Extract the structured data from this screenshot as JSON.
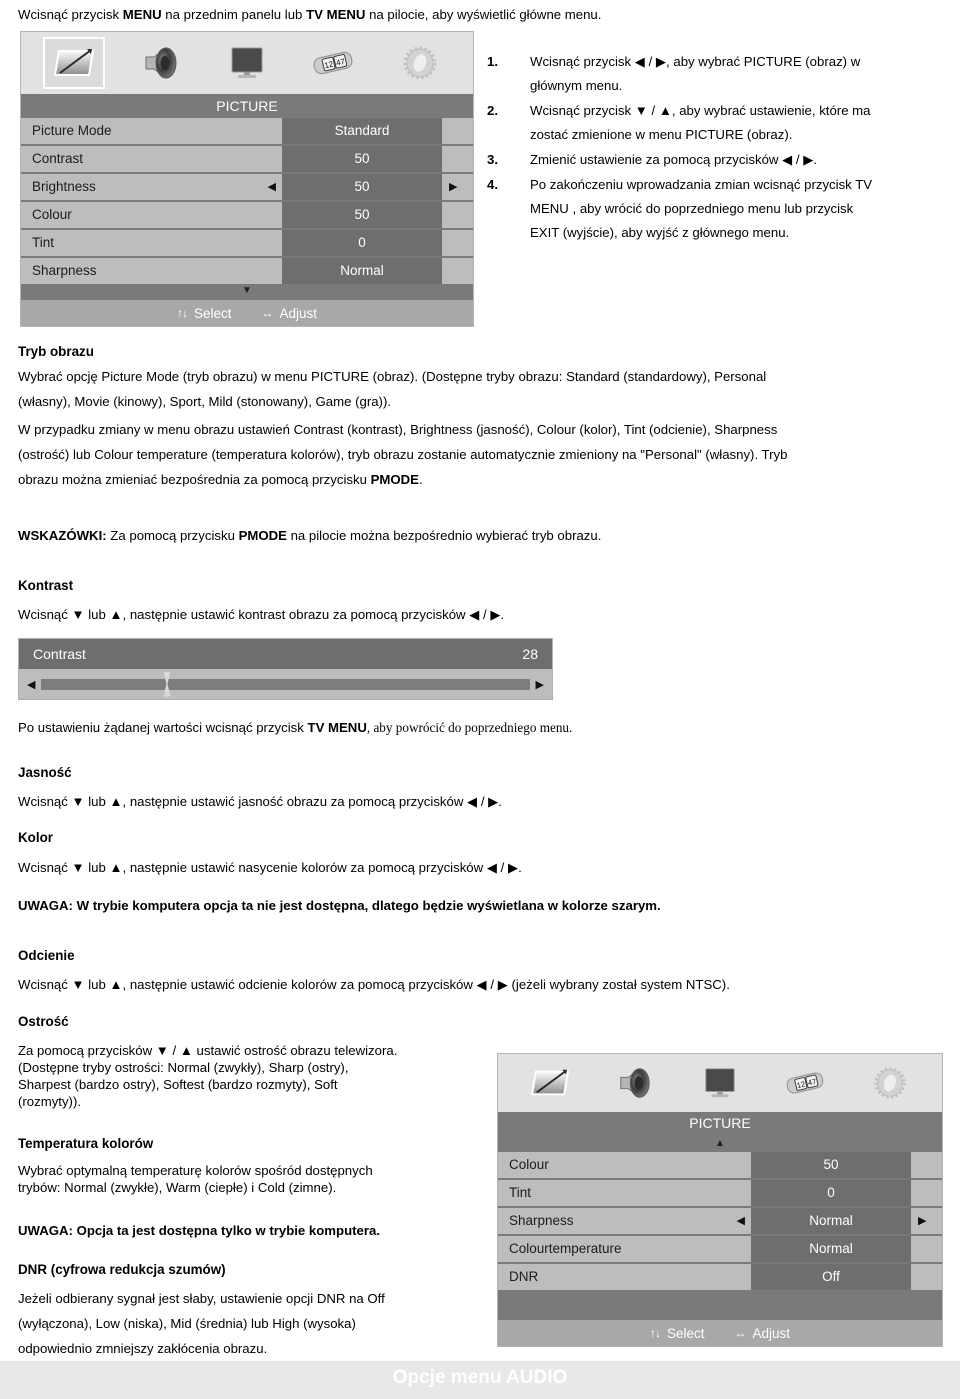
{
  "intro": {
    "before": "Wcisnąć przycisk ",
    "b1": "MENU",
    "mid": " na przednim panelu lub ",
    "b2": "TV MENU",
    "after": " na pilocie, aby wyświetlić główne menu."
  },
  "steps": [
    {
      "num": "1.",
      "lines": [
        "Wcisnąć przycisk ◀ / ▶, aby wybrać PICTURE (obraz) w",
        "głównym menu."
      ]
    },
    {
      "num": "2.",
      "lines": [
        "Wcisnąć przycisk ▼ / ▲, aby wybrać ustawienie, które ma",
        "zostać zmienione w menu  PICTURE (obraz)."
      ]
    },
    {
      "num": "3.",
      "lines": [
        "Zmienić ustawienie za pomocą przycisków ◀ / ▶."
      ]
    },
    {
      "num": "4.",
      "lines": [
        "Po zakończeniu wprowadzania zmian wcisnąć przycisk TV",
        "MENU , aby wrócić do poprzedniego menu lub przycisk",
        "EXIT (wyjście), aby wyjść z głównego menu."
      ]
    }
  ],
  "osd_top": {
    "title": "PICTURE",
    "icons": [
      "picture-icon",
      "speaker-icon",
      "screen-icon",
      "timer-icon",
      "setup-icon"
    ],
    "rows": [
      {
        "label": "Picture  Mode",
        "value": "Standard",
        "selected": false
      },
      {
        "label": "Contrast",
        "value": "50",
        "selected": false
      },
      {
        "label": "Brightness",
        "value": "50",
        "selected": true
      },
      {
        "label": "Colour",
        "value": "50",
        "selected": false
      },
      {
        "label": "Tint",
        "value": "0",
        "selected": false
      },
      {
        "label": "Sharpness",
        "value": "Normal",
        "selected": false
      }
    ],
    "scroll_glyph": "▼",
    "footer": {
      "select_glyph": "↑↓",
      "select_label": "Select",
      "adjust_glyph": "↔",
      "adjust_label": "Adjust"
    }
  },
  "osd_bottom": {
    "title": "PICTURE",
    "icons": [
      "picture-icon",
      "speaker-icon",
      "screen-icon",
      "timer-icon",
      "setup-icon"
    ],
    "scroll_glyph": "▲",
    "rows": [
      {
        "label": "Colour",
        "value": "50",
        "selected": false
      },
      {
        "label": "Tint",
        "value": "0",
        "selected": false
      },
      {
        "label": "Sharpness",
        "value": "Normal",
        "selected": true
      },
      {
        "label": "Colourtemperature",
        "value": "Normal",
        "selected": false
      },
      {
        "label": "DNR",
        "value": "Off",
        "selected": false
      }
    ],
    "footer": {
      "select_glyph": "↑↓",
      "select_label": "Select",
      "adjust_glyph": "↔",
      "adjust_label": "Adjust"
    }
  },
  "sections": {
    "tryb_obrazu_heading": "Tryb obrazu",
    "tryb_obrazu_l1": "Wybrać opcję Picture Mode (tryb obrazu) w menu PICTURE (obraz). (Dostępne tryby obrazu: Standard (standardowy), Personal",
    "tryb_obrazu_l2": "(własny), Movie (kinowy), Sport, Mild (stonowany), Game (gra)).",
    "tryb_obrazu_l3": "W przypadku zmiany w menu obrazu ustawień Contrast (kontrast), Brightness (jasność), Colour (kolor), Tint (odcienie), Sharpness",
    "tryb_obrazu_l4": "(ostrość) lub Colour temperature (temperatura kolorów), tryb obrazu zostanie automatycznie zmieniony na \"Personal\" (własny). Tryb",
    "tryb_obrazu_l5a": "obrazu można zmieniać bezpośrednia za pomocą przycisku ",
    "tryb_obrazu_l5b": "PMODE",
    "tryb_obrazu_l5c": ".",
    "wskazowki_a": "WSKAZÓWKI:",
    "wskazowki_b": " Za pomocą przycisku ",
    "wskazowki_c": "PMODE",
    "wskazowki_d": " na pilocie można bezpośrednio wybierać tryb obrazu.",
    "kontrast_heading": "Kontrast",
    "kontrast_line": "Wcisnąć ▼ lub ▲, następnie ustawić kontrast obrazu za pomocą przycisków ◀ / ▶.",
    "po_ustawieniu_a": "Po ustawieniu żądanej wartości wcisnąć przycisk ",
    "po_ustawieniu_b": "TV MENU",
    "po_ustawieniu_c": ", aby powrócić do poprzedniego menu.",
    "jasnosc_heading": "Jasność",
    "jasnosc_line": "Wcisnąć ▼ lub ▲, następnie ustawić jasność obrazu za pomocą przycisków ◀ / ▶.",
    "kolor_heading": "Kolor",
    "kolor_line": "Wcisnąć ▼ lub ▲, następnie ustawić nasycenie kolorów za pomocą przycisków ◀ / ▶.",
    "uwaga_szary": "UWAGA: W trybie komputera opcja ta nie jest dostępna, dlatego będzie wyświetlana w kolorze szarym.",
    "odcienie_heading": "Odcienie",
    "odcienie_line": "Wcisnąć ▼ lub ▲, następnie ustawić odcienie kolorów za pomocą przycisków ◀ / ▶ (jeżeli wybrany został system NTSC).",
    "ostrosc_heading": "Ostrość",
    "ostrosc_l1": "Za pomocą przycisków ▼ / ▲  ustawić ostrość obrazu telewizora.",
    "ostrosc_l2": "(Dostępne tryby ostrości: Normal (zwykły), Sharp (ostry),",
    "ostrosc_l3": "Sharpest (bardzo ostry), Softest (bardzo rozmyty), Soft",
    "ostrosc_l4": "(rozmyty)).",
    "temperatura_heading": "Temperatura kolorów",
    "temperatura_l1": "Wybrać optymalną temperaturę kolorów spośród dostępnych",
    "temperatura_l2": "trybów: Normal (zwykłe), Warm (ciepłe) i Cold (zimne).",
    "uwaga_komputer": "UWAGA: Opcja ta jest dostępna tylko w trybie komputera.",
    "dnr_heading": "DNR (cyfrowa redukcja szumów)",
    "dnr_l1": "Jeżeli odbierany sygnał jest słaby, ustawienie opcji DNR na Off",
    "dnr_l2": "(wyłączona), Low (niska), Mid (średnia) lub High (wysoka)",
    "dnr_l3": "odpowiednio zmniejszy zakłócenia obrazu."
  },
  "slider": {
    "label": "Contrast",
    "value": "28",
    "left_arrow": "◀",
    "right_arrow": "▶",
    "percent": 25
  },
  "footer_band": {
    "text": "Opcje menu AUDIO"
  },
  "colors": {
    "osd_bg": "#c9c9c9",
    "osd_header": "#7a7a7a",
    "osd_row_label": "#bdbdbd",
    "osd_row_value": "#6e6e6e",
    "osd_footer": "#a8a8a8",
    "icon_strip": "#e2e2e2",
    "footer_band": "#e8e8e8"
  }
}
